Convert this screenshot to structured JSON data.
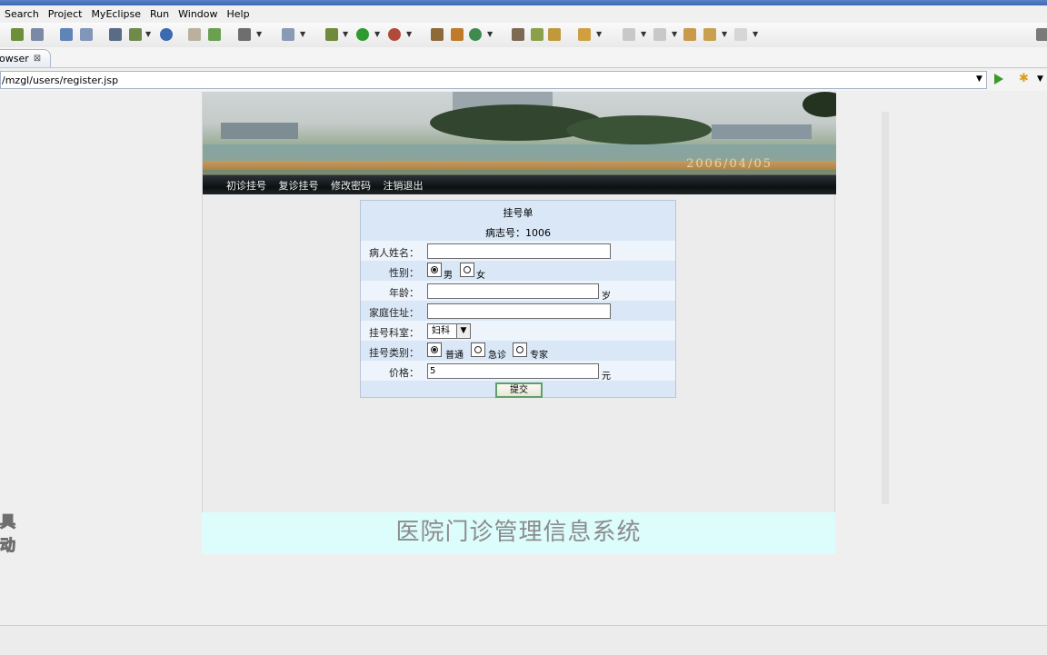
{
  "menu": [
    "Search",
    "Project",
    "MyEclipse",
    "Run",
    "Window",
    "Help"
  ],
  "tab": {
    "label": "owser",
    "close": "⊠"
  },
  "address": {
    "url": "/mzgl/users/register.jsp"
  },
  "banner": {
    "date": "2006/04/05"
  },
  "nav": [
    "初诊挂号",
    "复诊挂号",
    "修改密码",
    "注销退出"
  ],
  "form": {
    "title": "挂号单",
    "record": {
      "label": "病志号：",
      "value": "1006"
    },
    "name_label": "病人姓名：",
    "name_value": "",
    "gender_label": "性别：",
    "gender_options": [
      "男",
      "女"
    ],
    "gender_selected": "男",
    "age_label": "年龄：",
    "age_value": "",
    "age_unit": "岁",
    "address_label": "家庭住址：",
    "address_value": "",
    "dept_label": "挂号科室：",
    "dept_selected": "妇科",
    "type_label": "挂号类别：",
    "type_options": [
      "普通",
      "急诊",
      "专家"
    ],
    "type_selected": "普通",
    "price_label": "价格：",
    "price_value": "5",
    "price_unit": "元",
    "submit_label": "提交"
  },
  "footer": {
    "title": "医院门诊管理信息系统"
  },
  "watermark": [
    "具",
    "动"
  ]
}
